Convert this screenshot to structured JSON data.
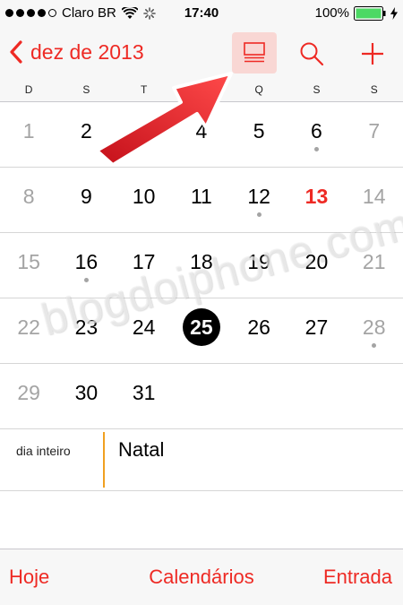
{
  "status_bar": {
    "carrier": "Claro BR",
    "time": "17:40",
    "battery": "100%",
    "signal_bars_filled": 4,
    "signal_bars_total": 5
  },
  "nav": {
    "back_label": "dez de 2013",
    "list_icon": "list-view-icon",
    "search_icon": "search-icon",
    "add_icon": "plus-icon"
  },
  "weekdays": [
    "D",
    "S",
    "T",
    "Q",
    "Q",
    "S",
    "S"
  ],
  "weeks": [
    [
      {
        "n": "1",
        "t": "weekend"
      },
      {
        "n": "2",
        "t": "normal"
      },
      {
        "n": "",
        "t": "normal"
      },
      {
        "n": "4",
        "t": "normal"
      },
      {
        "n": "5",
        "t": "normal"
      },
      {
        "n": "6",
        "t": "normal",
        "dot": true
      },
      {
        "n": "7",
        "t": "weekend"
      }
    ],
    [
      {
        "n": "8",
        "t": "weekend"
      },
      {
        "n": "9",
        "t": "normal"
      },
      {
        "n": "10",
        "t": "normal"
      },
      {
        "n": "11",
        "t": "normal"
      },
      {
        "n": "12",
        "t": "normal",
        "dot": true
      },
      {
        "n": "13",
        "t": "today"
      },
      {
        "n": "14",
        "t": "weekend"
      }
    ],
    [
      {
        "n": "15",
        "t": "weekend"
      },
      {
        "n": "16",
        "t": "normal",
        "dot": true
      },
      {
        "n": "17",
        "t": "normal"
      },
      {
        "n": "18",
        "t": "normal"
      },
      {
        "n": "19",
        "t": "normal"
      },
      {
        "n": "20",
        "t": "normal"
      },
      {
        "n": "21",
        "t": "weekend"
      }
    ],
    [
      {
        "n": "22",
        "t": "weekend"
      },
      {
        "n": "23",
        "t": "normal"
      },
      {
        "n": "24",
        "t": "normal"
      },
      {
        "n": "25",
        "t": "selected"
      },
      {
        "n": "26",
        "t": "normal"
      },
      {
        "n": "27",
        "t": "normal"
      },
      {
        "n": "28",
        "t": "weekend",
        "dot": true
      }
    ],
    [
      {
        "n": "29",
        "t": "weekend"
      },
      {
        "n": "30",
        "t": "normal"
      },
      {
        "n": "31",
        "t": "normal"
      },
      {
        "n": "",
        "t": "empty"
      },
      {
        "n": "",
        "t": "empty"
      },
      {
        "n": "",
        "t": "empty"
      },
      {
        "n": "",
        "t": "empty"
      }
    ]
  ],
  "events": {
    "allday_label": "dia inteiro",
    "title": "Natal",
    "bar_color": "#f0a020"
  },
  "watermark": "blogdoiphone.com",
  "toolbar": {
    "today": "Hoje",
    "calendars": "Calendários",
    "inbox": "Entrada"
  },
  "colors": {
    "accent": "#ee2a24",
    "weekend_text": "#a4a4a4",
    "highlight_bg": "#f9d7d4"
  }
}
